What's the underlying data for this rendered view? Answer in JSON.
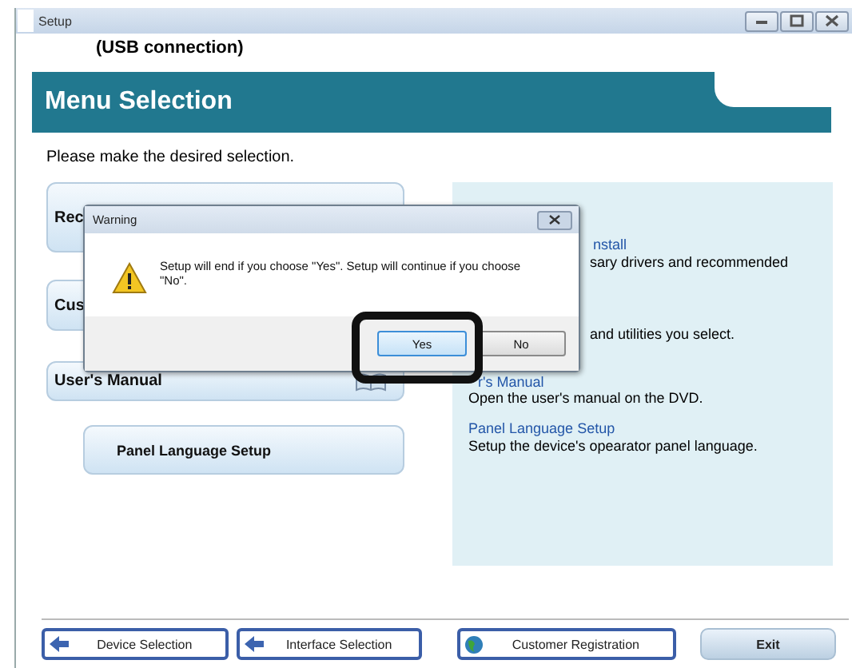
{
  "window": {
    "title": "Setup"
  },
  "subtitle": "(USB connection)",
  "banner": "Menu Selection",
  "instruction": "Please make the desired selection.",
  "menu_buttons": [
    {
      "label": "Rec",
      "kind": "alert"
    },
    {
      "label": "Cus",
      "kind": "main"
    },
    {
      "label": "User's Manual",
      "kind": "manual"
    },
    {
      "label": "Panel Language Setup",
      "kind": "sub"
    }
  ],
  "descriptions": [
    {
      "kind": "install",
      "title": "nstall",
      "text": "sary drivers and recommended"
    },
    {
      "kind": "custom",
      "text": "and utilities you select."
    },
    {
      "kind": "manual",
      "title": "r's Manual",
      "text": "Open the user's manual on the DVD."
    },
    {
      "kind": "full",
      "title": "Panel Language Setup",
      "text": "Setup the device's opearator panel language."
    }
  ],
  "bottom_buttons": [
    {
      "label": "Device Selection",
      "kind": "back"
    },
    {
      "label": "Interface Selection",
      "kind": "back"
    },
    {
      "label": "Customer Registration",
      "kind": "globe"
    },
    {
      "label": "Exit",
      "kind": "plain"
    }
  ],
  "dialog": {
    "title": "Warning",
    "message": "Setup will end if you choose \"Yes\". Setup will continue if you choose \"No\".",
    "buttons": [
      {
        "label": "Yes",
        "selected": true
      },
      {
        "label": "No",
        "selected": false
      }
    ]
  }
}
